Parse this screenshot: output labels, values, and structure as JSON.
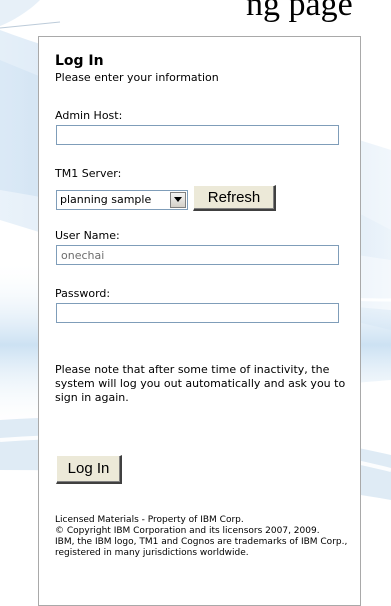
{
  "header": {
    "partial_heading": "ng page"
  },
  "login": {
    "title": "Log In",
    "subtitle": "Please enter your information",
    "admin_host": {
      "label": "Admin Host:",
      "value": ""
    },
    "tm1_server": {
      "label": "TM1 Server:",
      "selected": "planning sample"
    },
    "refresh_label": "Refresh",
    "user_name": {
      "label": "User Name:",
      "value": "onechai"
    },
    "password": {
      "label": "Password:",
      "value": ""
    },
    "note": "Please note that after some time of inactivity, the system will log you out automatically and ask you to sign in again.",
    "login_button_label": "Log In",
    "legal": {
      "line1": "Licensed Materials - Property of IBM Corp.",
      "line2": "© Copyright IBM Corporation and its licensors 2007, 2009.",
      "line3": "IBM, the IBM logo, TM1 and Cognos are trademarks of IBM Corp., registered in many jurisdictions worldwide."
    }
  },
  "colors": {
    "input_border": "#7f9db9",
    "panel_border": "#a9a9a9",
    "button_face": "#ece9d8",
    "background_swoosh": "#b9d6ee"
  }
}
